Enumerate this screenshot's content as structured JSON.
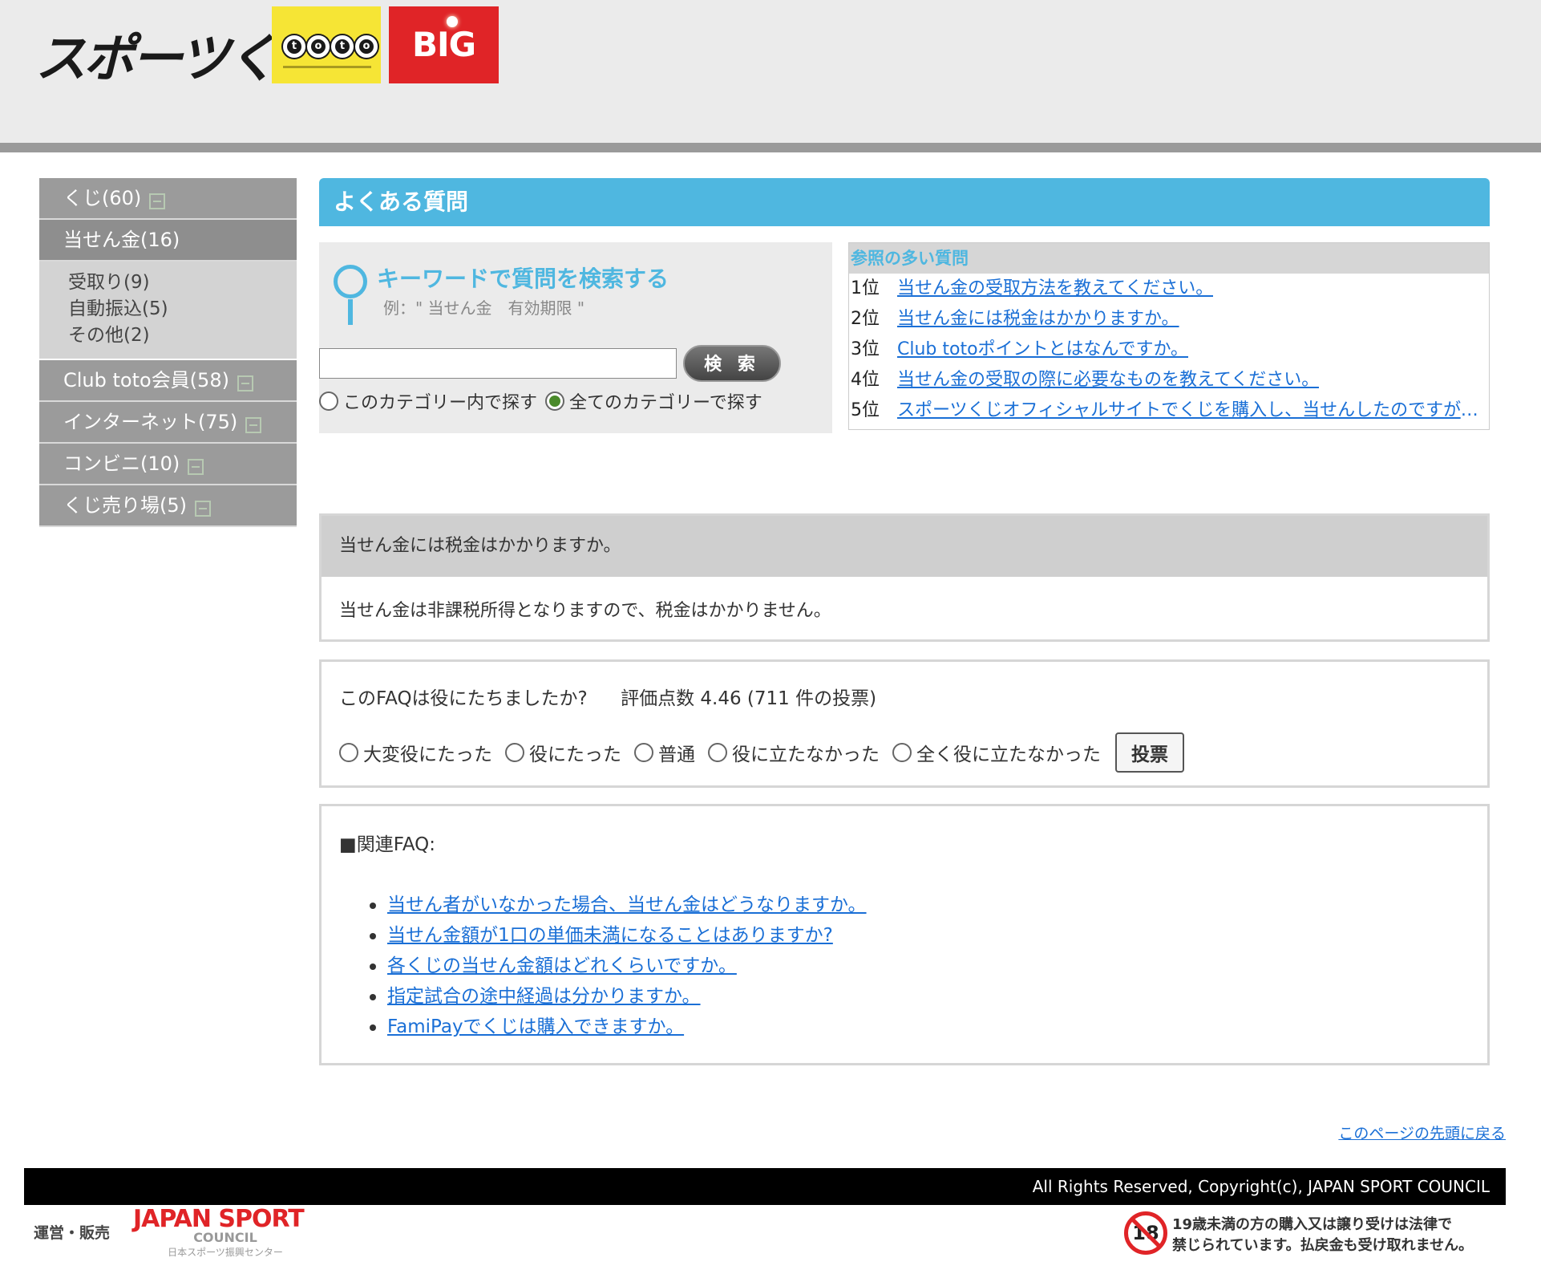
{
  "header": {
    "brand": "スポーツくじ",
    "toto_logo": "toto",
    "big_logo": "BIG"
  },
  "sidebar": {
    "items": [
      {
        "label": "くじ(60)"
      },
      {
        "label": "当せん金(16)"
      },
      {
        "label": "Club toto会員(58)"
      },
      {
        "label": "インターネット(75)"
      },
      {
        "label": "コンビニ(10)"
      },
      {
        "label": "くじ売り場(5)"
      }
    ],
    "subitems": [
      "受取り(9)",
      "自動振込(5)",
      "その他(2)"
    ]
  },
  "page_title": "よくある質問",
  "search": {
    "heading": "キーワードで質問を検索する",
    "example": "例：\" 当せん金　有効期限 \"",
    "input_value": "",
    "button_label": "検 索",
    "scope_options": [
      "このカテゴリー内で探す",
      "全てのカテゴリーで探す"
    ],
    "selected_scope": "全てのカテゴリーで探す"
  },
  "popular": {
    "heading": "参照の多い質問",
    "items": [
      {
        "rank": "1位",
        "text": "当せん金の受取方法を教えてください。"
      },
      {
        "rank": "2位",
        "text": "当せん金には税金はかかりますか。"
      },
      {
        "rank": "3位",
        "text": "Club totoポイントとはなんですか。"
      },
      {
        "rank": "4位",
        "text": "当せん金の受取の際に必要なものを教えてください。"
      },
      {
        "rank": "5位",
        "text": "スポーツくじオフィシャルサイトでくじを購入し、当せんしたのですが、当…"
      }
    ]
  },
  "qa": {
    "question": "当せん金には税金はかかりますか。",
    "answer": "当せん金は非課税所得となりますので、税金はかかりません。"
  },
  "rating": {
    "question": "このFAQは役にたちましたか?",
    "score_text": "評価点数 4.46 (711 件の投票)",
    "options": [
      "大変役にたった",
      "役にたった",
      "普通",
      "役に立たなかった",
      "全く役に立たなかった"
    ],
    "vote_label": "投票"
  },
  "related": {
    "title": "■関連FAQ:",
    "items": [
      "当せん者がいなかった場合、当せん金はどうなりますか。",
      "当せん金額が1口の単価未満になることはありますか?",
      "各くじの当せん金額はどれくらいですか。",
      "指定試合の途中経過は分かりますか。",
      "FamiPayでくじは購入できますか。"
    ]
  },
  "back_to_top": "このページの先頭に戻る",
  "footer": {
    "copyright": "All Rights Reserved, Copyright(c), JAPAN SPORT COUNCIL",
    "operator_label": "運営・販売",
    "logo_main": "JAPAN SPORT",
    "logo_sub": "COUNCIL",
    "logo_jp": "日本スポーツ振興センター",
    "age_mark": "18",
    "age_notice_line1": "19歳未満の方の購入又は譲り受けは法律で",
    "age_notice_line2": "禁じられています。払戻金も受け取れません。"
  }
}
